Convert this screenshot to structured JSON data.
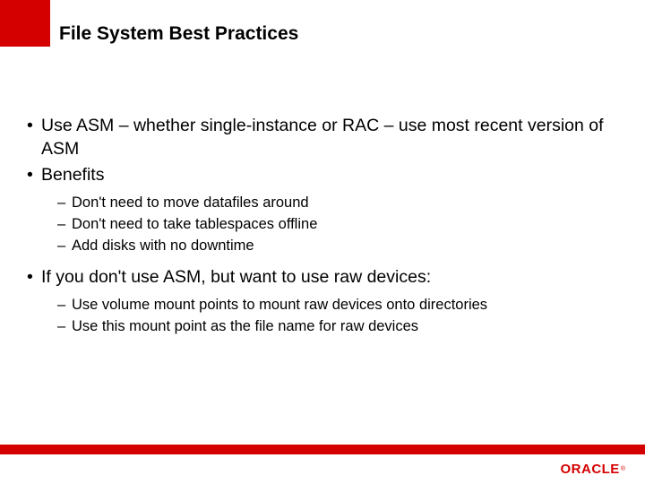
{
  "title": "File System Best Practices",
  "bullets": [
    {
      "text": "Use ASM – whether single-instance or RAC – use most recent version of ASM"
    },
    {
      "text": "Benefits",
      "sub": [
        "Don't need to  move datafiles around",
        "Don't need to take tablespaces offline",
        "Add disks with no downtime"
      ]
    },
    {
      "text": "If you don't use ASM, but want to use raw devices:",
      "sub": [
        "Use volume mount points to mount raw devices onto directories",
        "Use this mount point as the file name for raw devices"
      ]
    }
  ],
  "logo": {
    "text": "ORACLE",
    "registered": "®"
  }
}
